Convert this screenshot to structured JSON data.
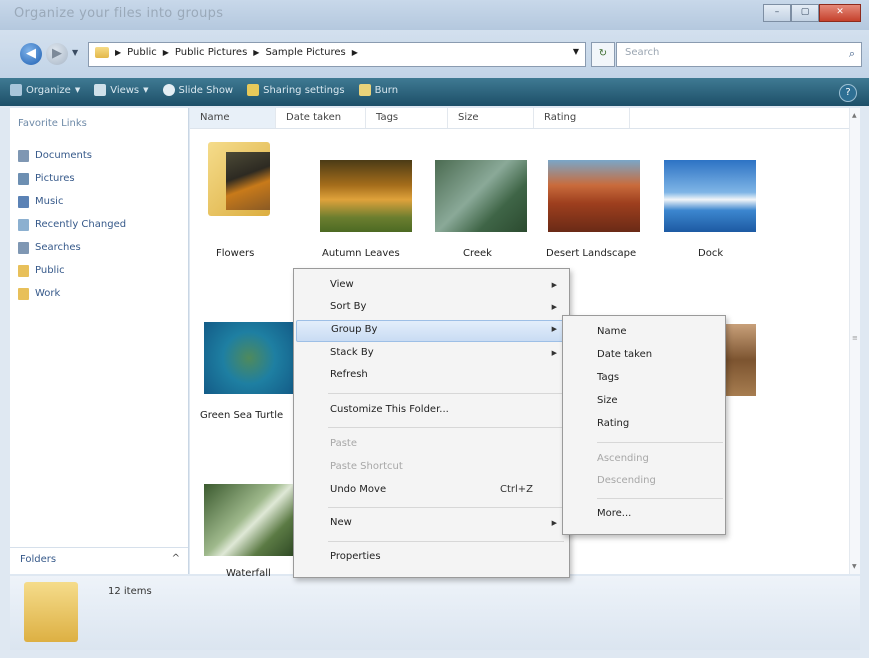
{
  "window": {
    "title": "Organize your files into groups"
  },
  "address": {
    "crumbs": [
      "Public",
      "Public Pictures",
      "Sample Pictures"
    ]
  },
  "search": {
    "placeholder": "Search"
  },
  "toolbar": {
    "items": [
      "Organize",
      "Views",
      "Slide Show",
      "Sharing settings",
      "Burn"
    ]
  },
  "sidebar": {
    "header": "Favorite Links",
    "items": [
      "Documents",
      "Pictures",
      "Music",
      "Recently Changed",
      "Searches",
      "Public",
      "Work"
    ],
    "folders_label": "Folders"
  },
  "columns": [
    "Name",
    "Date taken",
    "Tags",
    "Size",
    "Rating"
  ],
  "files": [
    "Flowers",
    "Autumn Leaves",
    "Creek",
    "Desert Landscape",
    "Dock",
    "Green Sea Turtle",
    "Waterfall"
  ],
  "status": {
    "count": "12 items"
  },
  "context_menu": {
    "items": [
      "View",
      "Sort By",
      "Group By",
      "Stack By",
      "Refresh",
      "Customize This Folder...",
      "Paste",
      "Paste Shortcut",
      "Undo Move",
      "New",
      "Properties"
    ],
    "undo_shortcut": "Ctrl+Z"
  },
  "group_by_submenu": {
    "items": [
      "Name",
      "Date taken",
      "Tags",
      "Size",
      "Rating",
      "Ascending",
      "Descending",
      "More..."
    ]
  },
  "colors": {
    "toolbar": "#2a5f78",
    "highlight": "#c9dcf3",
    "folder": "#e8c05a",
    "link": "#36598a"
  }
}
